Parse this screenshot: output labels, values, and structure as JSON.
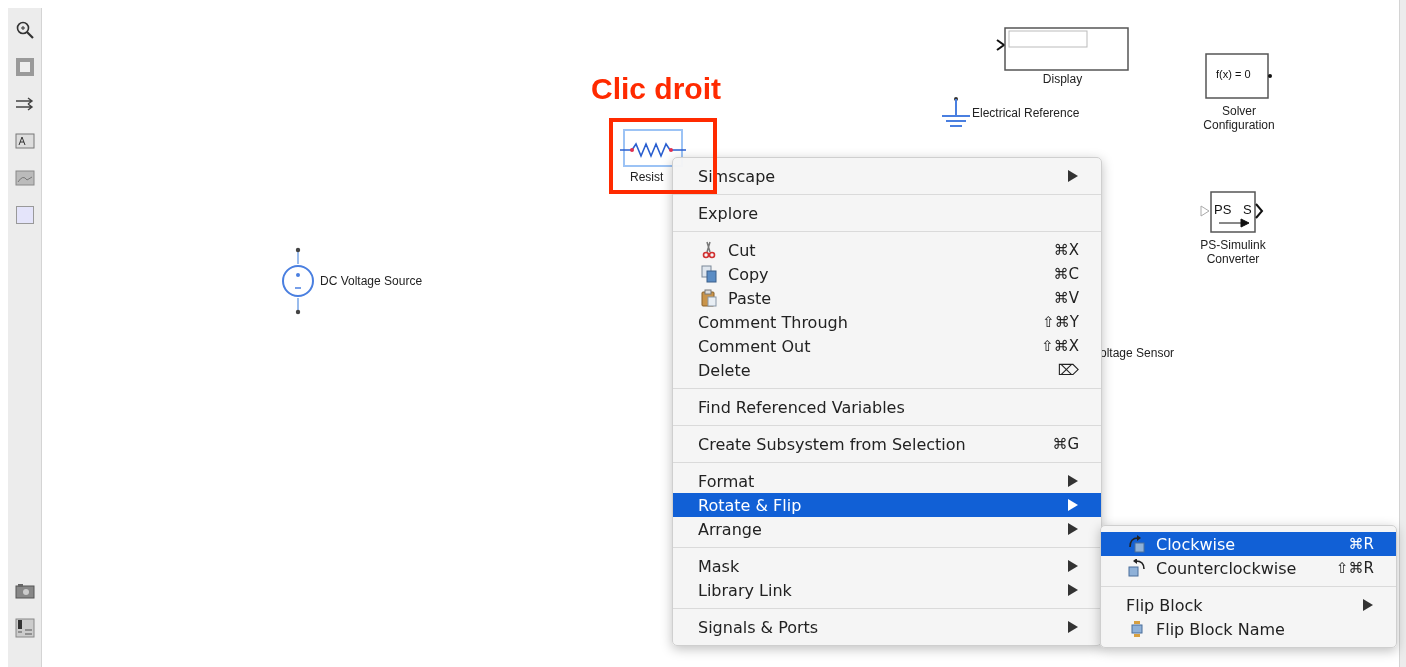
{
  "annotation": {
    "text": "Clic droit"
  },
  "blocks": [
    {
      "kind": "display",
      "label": "Display"
    },
    {
      "kind": "ground",
      "label": "Electrical Reference"
    },
    {
      "kind": "solver",
      "label": "Solver Configuration",
      "inner_text": "f(x) = 0"
    },
    {
      "kind": "converter",
      "label": "PS-Simulink Converter",
      "inner_text": "PS",
      "inner_text_2": "S"
    },
    {
      "kind": "dc-source",
      "label": "DC Voltage Source"
    },
    {
      "kind": "resistor",
      "label": "Resist"
    },
    {
      "kind": "sensor",
      "label": "oltage Sensor"
    }
  ],
  "context_menu": {
    "sections": [
      [
        {
          "label": "Simscape",
          "kind": "plain",
          "submenu": true,
          "selected": false
        }
      ],
      [
        {
          "label": "Explore",
          "kind": "plain",
          "submenu": false,
          "selected": false
        }
      ],
      [
        {
          "label": "Cut",
          "kind": "cut",
          "shortcut": "⌘X",
          "submenu": false,
          "selected": false
        },
        {
          "label": "Copy",
          "kind": "copy",
          "shortcut": "⌘C",
          "submenu": false,
          "selected": false
        },
        {
          "label": "Paste",
          "kind": "paste",
          "shortcut": "⌘V",
          "submenu": false,
          "selected": false
        },
        {
          "label": "Comment Through",
          "kind": "plain",
          "shortcut": "⇧⌘Y",
          "submenu": false,
          "selected": false
        },
        {
          "label": "Comment Out",
          "kind": "plain",
          "shortcut": "⇧⌘X",
          "submenu": false,
          "selected": false
        },
        {
          "label": "Delete",
          "kind": "plain",
          "shortcut": "⌦",
          "submenu": false,
          "selected": false
        }
      ],
      [
        {
          "label": "Find Referenced Variables",
          "kind": "plain",
          "submenu": false,
          "selected": false
        }
      ],
      [
        {
          "label": "Create Subsystem from Selection",
          "kind": "plain",
          "shortcut": "⌘G",
          "submenu": false,
          "selected": false
        }
      ],
      [
        {
          "label": "Format",
          "kind": "plain",
          "submenu": true,
          "selected": false
        },
        {
          "label": "Rotate & Flip",
          "kind": "plain",
          "submenu": true,
          "selected": true
        },
        {
          "label": "Arrange",
          "kind": "plain",
          "submenu": true,
          "selected": false
        }
      ],
      [
        {
          "label": "Mask",
          "kind": "plain",
          "submenu": true,
          "selected": false
        },
        {
          "label": "Library Link",
          "kind": "plain",
          "submenu": true,
          "selected": false
        }
      ],
      [
        {
          "label": "Signals & Ports",
          "kind": "plain",
          "submenu": true,
          "selected": false
        }
      ]
    ]
  },
  "submenu": {
    "sections": [
      [
        {
          "label": "Clockwise",
          "kind": "rotate-cw",
          "shortcut": "⌘R",
          "submenu": false,
          "selected": true
        },
        {
          "label": "Counterclockwise",
          "kind": "rotate-ccw",
          "shortcut": "⇧⌘R",
          "submenu": false,
          "selected": false
        }
      ],
      [
        {
          "label": "Flip Block",
          "kind": "plain",
          "submenu": true,
          "selected": false
        },
        {
          "label": "Flip Block Name",
          "kind": "flip-name",
          "submenu": false,
          "selected": false
        }
      ]
    ]
  }
}
